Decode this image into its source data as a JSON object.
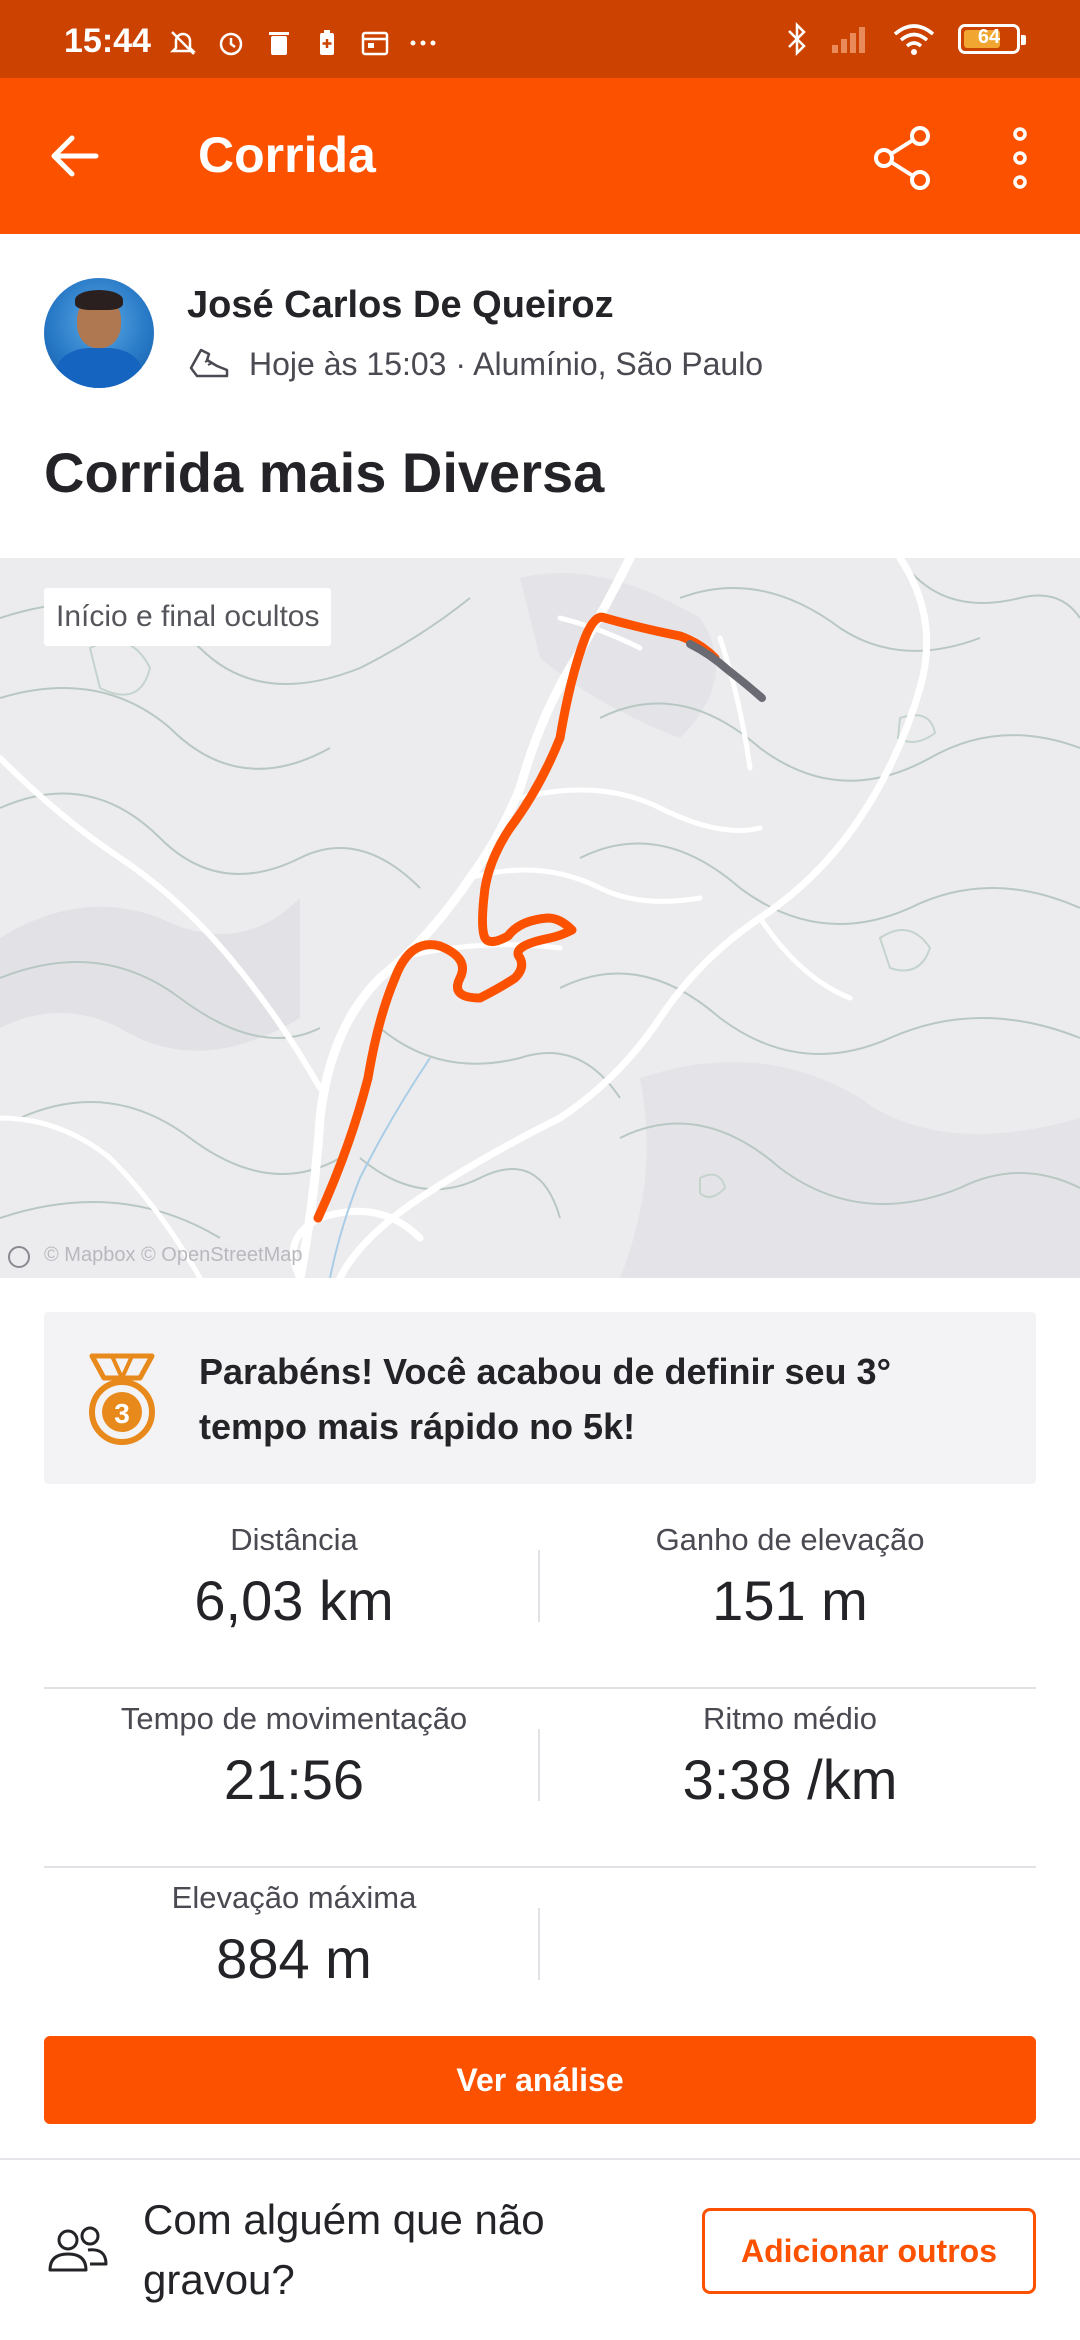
{
  "status_bar": {
    "time": "15:44",
    "battery": "64",
    "icons": [
      "mute-icon",
      "alarm-icon",
      "trash-icon",
      "battery-saver-icon",
      "calendar-icon",
      "more-dots-icon",
      "bluetooth-icon",
      "signal-icon",
      "wifi-icon",
      "battery-icon"
    ]
  },
  "app_bar": {
    "title": "Corrida",
    "color": "#fc5200"
  },
  "athlete": {
    "name": "José Carlos De Queiroz",
    "meta": "Hoje às 15:03 · Alumínio, São Paulo"
  },
  "activity": {
    "title": "Corrida mais Diversa"
  },
  "map": {
    "badge": "Início e final ocultos",
    "attribution": "© Mapbox © OpenStreetMap",
    "route_color": "#fc5200"
  },
  "achievement": {
    "text": "Parabéns! Você acabou de definir seu 3° tempo mais rápido no 5k!",
    "medal_number": "3",
    "medal_color": "#e8891c"
  },
  "stats": {
    "distance": {
      "label": "Distância",
      "value": "6,03 km"
    },
    "elevation_gain": {
      "label": "Ganho de elevação",
      "value": "151 m"
    },
    "moving_time": {
      "label": "Tempo de movimentação",
      "value": "21:56"
    },
    "avg_pace": {
      "label": "Ritmo médio",
      "value": "3:38 /km"
    },
    "max_elevation": {
      "label": "Elevação máxima",
      "value": "884 m"
    }
  },
  "actions": {
    "analysis_button": "Ver análise",
    "with_someone_text": "Com alguém que não gravou?",
    "add_others_button": "Adicionar outros"
  }
}
